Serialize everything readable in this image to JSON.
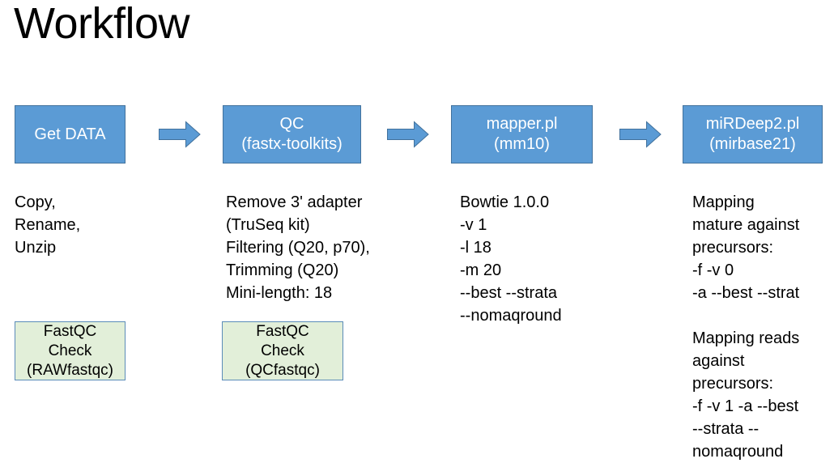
{
  "slide": {
    "title": "Workflow"
  },
  "colors": {
    "stage_fill": "#5B9BD5",
    "stage_border": "#41719C",
    "stage_text": "#FFFFFF",
    "arrow_fill": "#5B9BD5",
    "arrow_border": "#41719C",
    "check_fill": "#E2EFD9",
    "check_border": "#5B8CB8",
    "body_text": "#000000",
    "background": "#FFFFFF"
  },
  "stages": [
    {
      "id": "get-data",
      "title_line1": "Get DATA",
      "title_line2": "",
      "details": "Copy,\nRename,\nUnzip",
      "check": {
        "line1": "FastQC",
        "line2": "Check",
        "line3": "(RAWfastqc)"
      }
    },
    {
      "id": "qc",
      "title_line1": "QC",
      "title_line2": "(fastx-toolkits)",
      "details": "Remove 3' adapter\n(TruSeq kit)\nFiltering (Q20, p70),\nTrimming (Q20)\nMini-length: 18",
      "check": {
        "line1": "FastQC",
        "line2": "Check",
        "line3": "(QCfastqc)"
      }
    },
    {
      "id": "mapper",
      "title_line1": "mapper.pl",
      "title_line2": "(mm10)",
      "details": "Bowtie 1.0.0\n-v 1\n-l 18\n-m 20\n--best --strata\n--nomaqround",
      "check": null
    },
    {
      "id": "mirdeep2",
      "title_line1": "miRDeep2.pl",
      "title_line2": "(mirbase21)",
      "details": "Mapping\nmature against\nprecursors:\n-f -v 0\n-a --best --strat",
      "details2": "Mapping reads\nagainst\nprecursors:\n-f -v 1 -a --best\n--strata --\nnomaqround",
      "check": null
    }
  ],
  "arrows": [
    {
      "id": "arrow-1",
      "from": "get-data",
      "to": "qc"
    },
    {
      "id": "arrow-2",
      "from": "qc",
      "to": "mapper"
    },
    {
      "id": "arrow-3",
      "from": "mapper",
      "to": "mirdeep2"
    }
  ]
}
